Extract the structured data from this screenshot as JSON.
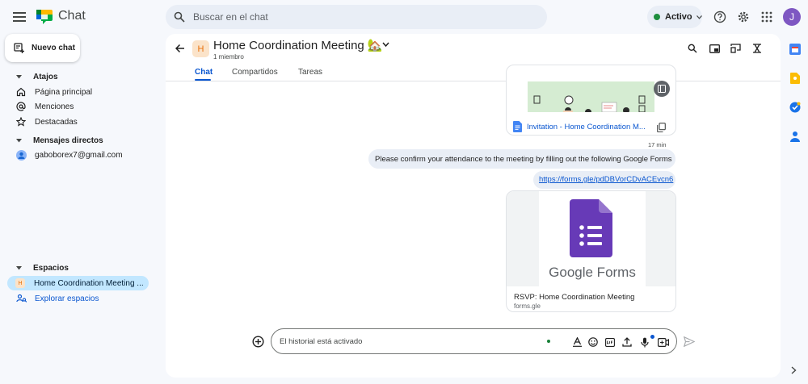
{
  "app": {
    "title": "Chat"
  },
  "search": {
    "placeholder": "Buscar en el chat"
  },
  "status": {
    "label": "Activo"
  },
  "account": {
    "initial": "J"
  },
  "sidebar": {
    "new_chat": "Nuevo chat",
    "shortcuts": {
      "title": "Atajos",
      "items": [
        "Página principal",
        "Menciones",
        "Destacadas"
      ]
    },
    "direct_messages": {
      "title": "Mensajes directos",
      "items": [
        "gaboborex7@gmail.com"
      ]
    },
    "spaces": {
      "title": "Espacios",
      "items": [
        {
          "initial": "H",
          "label": "Home Coordination Meeting ..."
        }
      ],
      "explore": "Explorar espacios"
    }
  },
  "room": {
    "initial": "H",
    "title": "Home Coordination Meeting 🏡",
    "members": "1 miembro",
    "tabs": [
      "Chat",
      "Compartidos",
      "Tareas"
    ]
  },
  "messages": {
    "doc_card_title": "Invitation - Home Coordination M...",
    "timestamp": "17 min",
    "text": "Please confirm your attendance to the meeting by filling out the following Google Forms",
    "link": "https://forms.gle/pdDBVorCDvACEvcn6",
    "preview": {
      "brand": "Google Forms",
      "title": "RSVP: Home Coordination Meeting",
      "domain": "forms.gle"
    }
  },
  "composer": {
    "placeholder": "El historial está activado"
  },
  "colors": {
    "accent": "#0b57d0",
    "active_status": "#1e8e3e",
    "avatar": "#7e57c2",
    "room_avatar": "#fbe3c9"
  }
}
